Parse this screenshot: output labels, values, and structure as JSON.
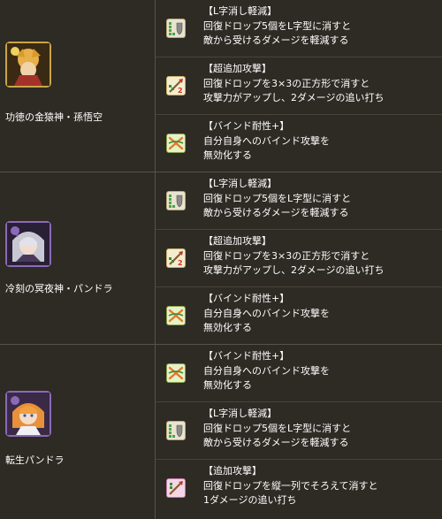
{
  "characters": [
    {
      "name": "功徳の金猿神・孫悟空",
      "portrait_icon": "sun-wukong-portrait",
      "skills": [
        {
          "icon": "l-shape-icon",
          "name": "【L字消し軽減】",
          "line1": "回復ドロップ5個をL字型に消すと",
          "line2": "敵から受けるダメージを軽減する"
        },
        {
          "icon": "super-extra-attack-icon",
          "name": "【超追加攻撃】",
          "line1": "回復ドロップを3×3の正方形で消すと",
          "line2": "攻撃力がアップし、2ダメージの追い打ち"
        },
        {
          "icon": "bind-resist-icon",
          "name": "【バインド耐性+】",
          "line1": "自分自身へのバインド攻撃を",
          "line2": "無効化する"
        }
      ]
    },
    {
      "name": "冷刻の冥夜神・パンドラ",
      "portrait_icon": "pandora-portrait",
      "skills": [
        {
          "icon": "l-shape-icon",
          "name": "【L字消し軽減】",
          "line1": "回復ドロップ5個をL字型に消すと",
          "line2": "敵から受けるダメージを軽減する"
        },
        {
          "icon": "super-extra-attack-icon",
          "name": "【超追加攻撃】",
          "line1": "回復ドロップを3×3の正方形で消すと",
          "line2": "攻撃力がアップし、2ダメージの追い打ち"
        },
        {
          "icon": "bind-resist-icon",
          "name": "【バインド耐性+】",
          "line1": "自分自身へのバインド攻撃を",
          "line2": "無効化する"
        }
      ]
    },
    {
      "name": "転生パンドラ",
      "portrait_icon": "reincarnated-pandora-portrait",
      "skills": [
        {
          "icon": "bind-resist-icon",
          "name": "【バインド耐性+】",
          "line1": "自分自身へのバインド攻撃を",
          "line2": "無効化する"
        },
        {
          "icon": "l-shape-icon",
          "name": "【L字消し軽減】",
          "line1": "回復ドロップ5個をL字型に消すと",
          "line2": "敵から受けるダメージを軽減する"
        },
        {
          "icon": "extra-attack-icon",
          "name": "【追加攻撃】",
          "line1": "回復ドロップを縦一列でそろえて消すと",
          "line2": "1ダメージの追い打ち"
        }
      ]
    }
  ],
  "colors": {
    "background": "#2e2a24",
    "border": "#5a5246",
    "text": "#ffffff"
  }
}
